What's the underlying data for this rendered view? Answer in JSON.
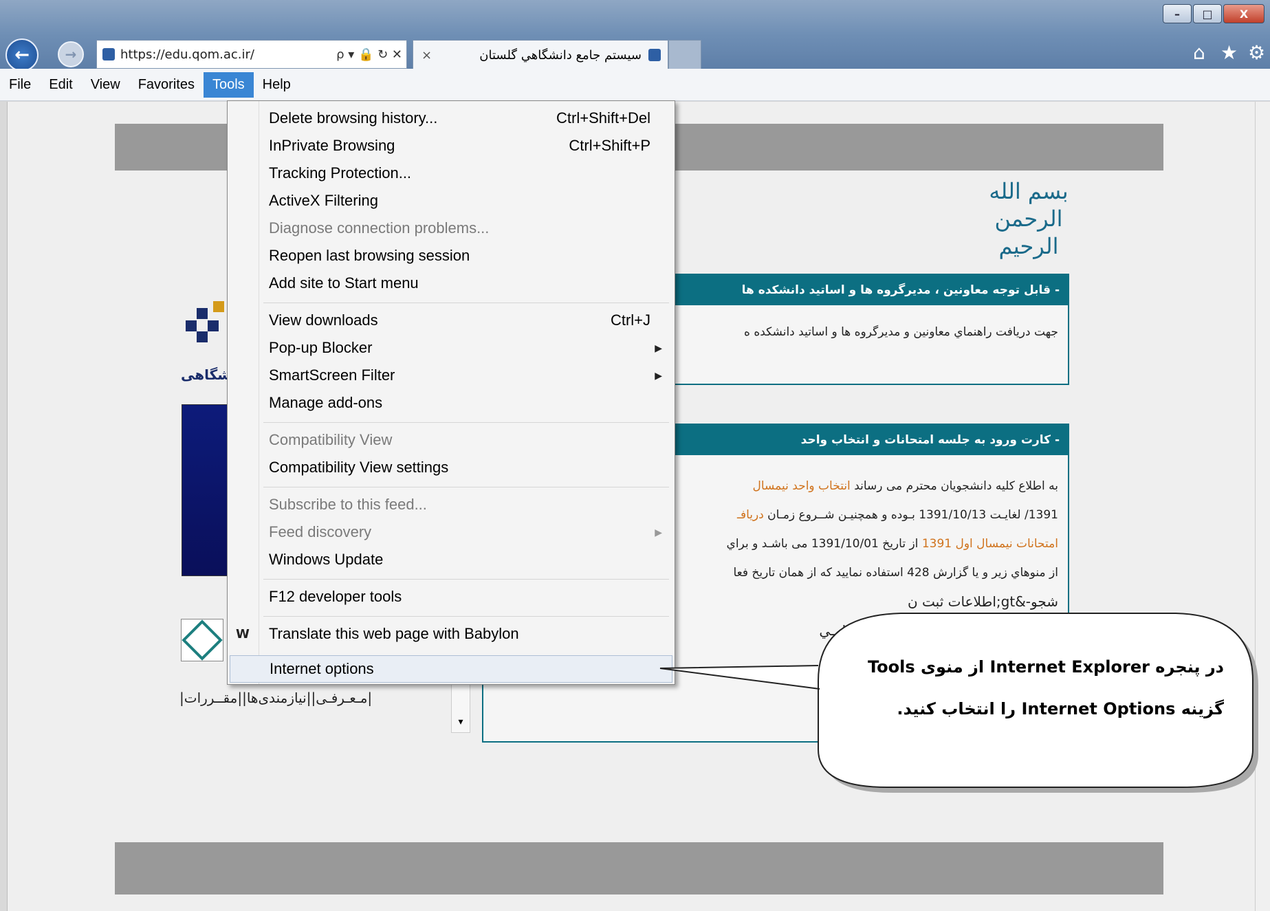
{
  "browser": {
    "url": "https://edu.qom.ac.ir/",
    "address_tools": "ρ ▾ 🔒 ↻ ✕",
    "tab_title": "سيستم جامع دانشگاهي گلستان",
    "tab_close": "×",
    "window_buttons": [
      "–",
      "□",
      "X"
    ],
    "toolbar_icons": [
      "home-icon",
      "favorites-star-icon",
      "gear-icon"
    ]
  },
  "menubar": {
    "items": [
      "File",
      "Edit",
      "View",
      "Favorites",
      "Tools",
      "Help"
    ],
    "active": "Tools"
  },
  "tools_menu": [
    {
      "label": "Delete browsing history...",
      "shortcut": "Ctrl+Shift+Del"
    },
    {
      "label": "InPrivate Browsing",
      "shortcut": "Ctrl+Shift+P"
    },
    {
      "label": "Tracking Protection..."
    },
    {
      "label": "ActiveX Filtering"
    },
    {
      "label": "Diagnose connection problems...",
      "disabled": true
    },
    {
      "label": "Reopen last browsing session"
    },
    {
      "label": "Add site to Start menu"
    },
    {
      "label": "View downloads",
      "shortcut": "Ctrl+J"
    },
    {
      "label": "Pop-up Blocker",
      "submenu": true
    },
    {
      "label": "SmartScreen Filter",
      "submenu": true
    },
    {
      "label": "Manage add-ons"
    },
    {
      "label": "Compatibility View",
      "disabled": true
    },
    {
      "label": "Compatibility View settings"
    },
    {
      "label": "Subscribe to this feed...",
      "disabled": true
    },
    {
      "label": "Feed discovery",
      "disabled": true,
      "submenu": true
    },
    {
      "label": "Windows Update"
    },
    {
      "label": "F12 developer tools"
    },
    {
      "label": "Translate this web page with Babylon"
    },
    {
      "label": "Internet options",
      "highlighted": true
    }
  ],
  "page": {
    "bismillah": "بسم الله الرحمن الرحيم",
    "logo_text": "شگاهی",
    "nav_links": "|مـعـرفـی||نیازمندی‌ها||مقــررات|",
    "announce1": {
      "title": "- قابل توجه معاونين ، مديرگروه ها و اساتيد دانشکده ها",
      "body": "جهت دريافت راهنماي معاونين و مديرگروه ها و اساتيد دانشکده ه"
    },
    "announce2": {
      "title": "- کارت ورود به جلسه امتحانات و انتخاب واحد",
      "line1": "به اطلاع کليه دانشجويان محترم می رساند ",
      "line1_highlight": "انتخاب واحد نيمسال",
      "line2": "1391/ لغايـت 1391/10/13 بـوده و همچنيـن شــروع زمـان ",
      "line2_highlight": "دريافـ",
      "line3_highlight": "امتحانات نيمسال اول 1391",
      "line3": " از تاريخ 1391/10/01 می باشـد و براي",
      "line4": "از منوهاي زير و يا گزارش 428 استفاده نماييد که از همان تاريخ فعا",
      "line5": "شجو-&gt;اطلاعات ثبت ن",
      "line6": "جلسه امتحانات در کليـه امتحانـات الزامـي"
    }
  },
  "callout": {
    "line1": "در پنجره Internet Explorer از منوی Tools",
    "line2": "گزینه Internet Options را انتخاب کنید."
  }
}
